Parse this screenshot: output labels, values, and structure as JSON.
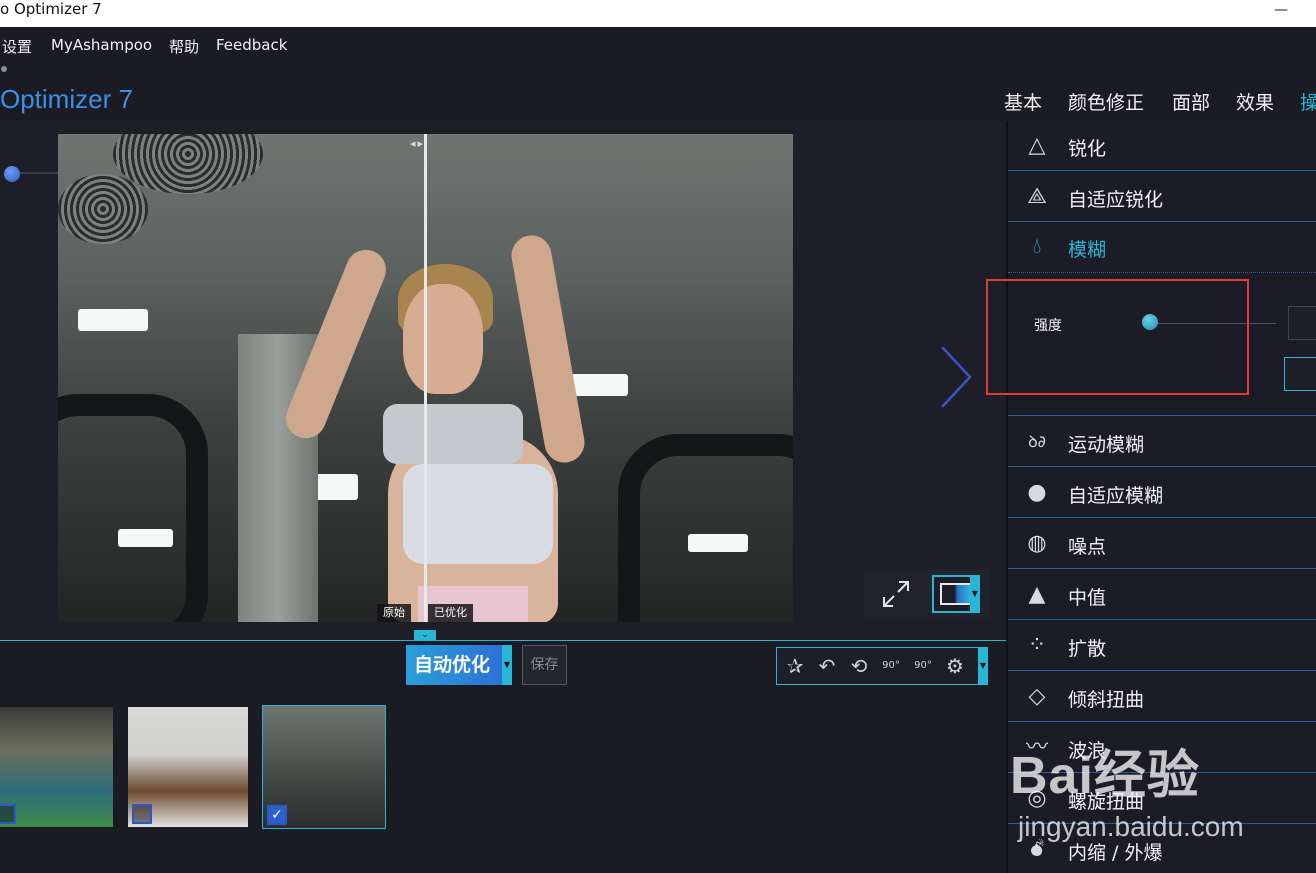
{
  "window": {
    "title": "o Optimizer 7",
    "minimize_glyph": "—"
  },
  "menu": [
    "设置",
    "MyAshampoo",
    "帮助",
    "Feedback"
  ],
  "app_title": "Optimizer 7",
  "tabs": [
    {
      "label": "基本"
    },
    {
      "label": "颜色修正"
    },
    {
      "label": "面部"
    },
    {
      "label": "效果"
    },
    {
      "label": "操"
    }
  ],
  "active_tab": "操",
  "zoom": {
    "plus_label": "+"
  },
  "compare": {
    "original_label": "原始",
    "optimized_label": "已优化"
  },
  "toolbar": {
    "auto_optimize_label": "自动优化",
    "save_label": "保存",
    "tool_icons": [
      "magic-stars-icon",
      "undo-icon",
      "undo-all-icon",
      "rotate-left-90-icon",
      "rotate-right-90-icon",
      "settings-gear-icon"
    ],
    "rotate_left_glyph": "90°",
    "rotate_right_glyph": "90°"
  },
  "filmstrip": [
    {
      "name": "gym-stretch",
      "checked": false
    },
    {
      "name": "man-typewriter",
      "checked": false
    },
    {
      "name": "gym-woman",
      "checked": true,
      "selected": true
    }
  ],
  "tools": [
    {
      "label": "锐化",
      "icon": "triangle-outline-icon"
    },
    {
      "label": "自适应锐化",
      "icon": "triangle-filled-icon"
    },
    {
      "label": "模糊",
      "icon": "water-drop-outline-icon",
      "active": true
    },
    {
      "label": "运动模糊",
      "icon": "motion-drops-icon"
    },
    {
      "label": "自适应模糊",
      "icon": "water-drop-filled-icon"
    },
    {
      "label": "噪点",
      "icon": "noise-sphere-icon"
    },
    {
      "label": "中值",
      "icon": "pyramid-icon"
    },
    {
      "label": "扩散",
      "icon": "diffuse-dots-icon"
    },
    {
      "label": "倾斜扭曲",
      "icon": "diamond-icon"
    },
    {
      "label": "波浪",
      "icon": "wave-icon"
    },
    {
      "label": "螺旋扭曲",
      "icon": "spiral-icon"
    },
    {
      "label": "内缩 / 外爆",
      "icon": "bomb-icon"
    }
  ],
  "blur_settings": {
    "strength_label": "强度",
    "strength_fraction": 0
  },
  "watermark": {
    "brand": "Bai经验",
    "url": "jingyan.baidu.com"
  },
  "colors": {
    "accent": "#27b6d6",
    "title_blue": "#3e8fe8",
    "highlight_box": "#e23b3b",
    "background": "#1b1b24"
  }
}
